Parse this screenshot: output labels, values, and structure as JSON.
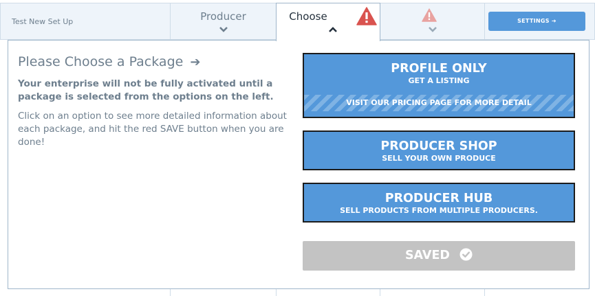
{
  "tabs": {
    "enterprise_name": "Test New Set Up",
    "producer_label": "Producer",
    "choose_label": "Choose",
    "settings_label": "SETTINGS"
  },
  "content": {
    "heading": "Please Choose a Package",
    "warning": "Your enterprise will not be fully activated until a package is selected from the options on the left.",
    "help": "Click on an option to see more detailed information about each package, and hit the red SAVE button when you are done!"
  },
  "packages": [
    {
      "title": "PROFILE ONLY",
      "subtitle": "GET A LISTING",
      "note": "VISIT OUR PRICING PAGE FOR MORE DETAIL"
    },
    {
      "title": "PRODUCER SHOP",
      "subtitle": "SELL YOUR OWN PRODUCE"
    },
    {
      "title": "PRODUCER HUB",
      "subtitle": "SELL PRODUCTS FROM MULTIPLE PRODUCERS."
    }
  ],
  "save_button": {
    "label": "SAVED"
  },
  "colors": {
    "accent_blue": "#5498da",
    "warning_red": "#d9534f",
    "warning_light": "#e8a2a0",
    "disabled_gray": "#c3c3c3",
    "text_muted": "#6e7f8e"
  },
  "icons": {
    "chevron_down": "chevron-down-icon",
    "chevron_up": "chevron-up-icon",
    "warning": "warning-triangle-icon",
    "arrow_right": "arrow-right-icon",
    "check": "check-circle-icon"
  }
}
